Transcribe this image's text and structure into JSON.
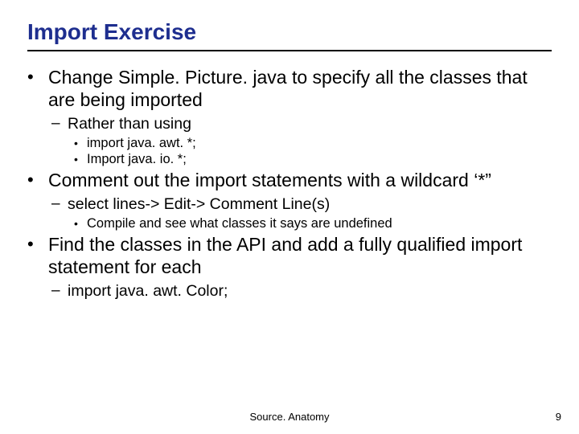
{
  "title": "Import Exercise",
  "bullets": [
    {
      "text": "Change Simple. Picture. java to specify all the classes that are being imported",
      "sub": [
        {
          "text": "Rather than using",
          "sub": [
            {
              "text": "import java. awt. *;"
            },
            {
              "text": "Import java. io. *;"
            }
          ]
        }
      ]
    },
    {
      "text": "Comment out the import statements with a wildcard ‘*”",
      "sub": [
        {
          "text": "select lines-> Edit-> Comment Line(s)",
          "sub": [
            {
              "text": "Compile and see what classes it says are undefined"
            }
          ]
        }
      ]
    },
    {
      "text": "Find the classes in the API and add a fully qualified import statement for each",
      "sub": [
        {
          "text": "import java. awt. Color;"
        }
      ]
    }
  ],
  "footer_center": "Source. Anatomy",
  "footer_right": "9"
}
